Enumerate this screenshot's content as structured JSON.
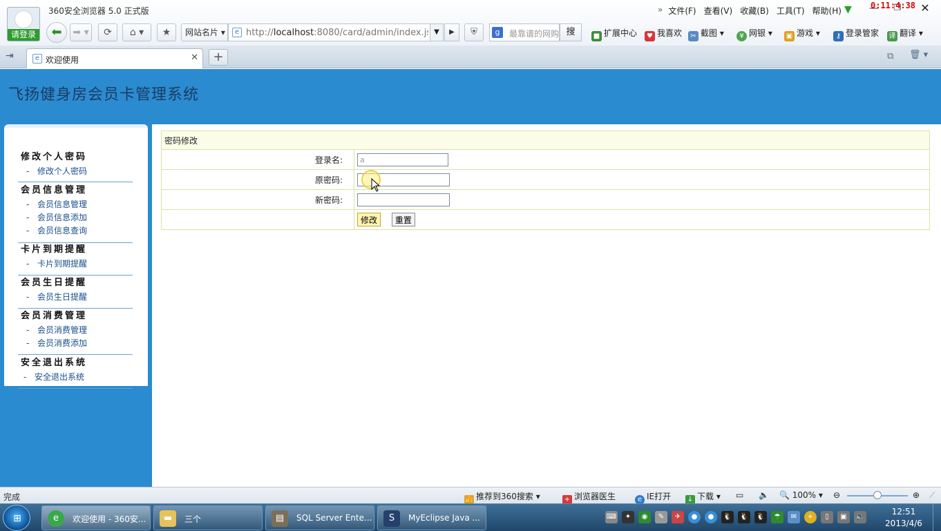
{
  "browser": {
    "app_title": "360安全浏览器 5.0 正式版",
    "login_label": "请登录",
    "menu": [
      "文件(F)",
      "查看(V)",
      "收藏(B)",
      "工具(T)",
      "帮助(H)"
    ],
    "recording_timer": "0:11:4:38",
    "site_names_label": "网站名片",
    "address": {
      "host_prefix": "http://",
      "host": "localhost",
      "rest": ":8080/card/admin/index.jsp"
    },
    "search_placeholder": "最靠谱的网购",
    "search_button": "搜",
    "extensions": [
      "扩展中心",
      "我喜欢",
      "截图",
      "网银",
      "游戏",
      "登录管家",
      "翻译"
    ],
    "tab": {
      "title": "欢迎使用"
    }
  },
  "page": {
    "site_title": "飞扬健身房会员卡管理系统",
    "nav": [
      {
        "heading": "修改个人密码",
        "items": [
          "修改个人密码"
        ]
      },
      {
        "heading": "会员信息管理",
        "items": [
          "会员信息管理",
          "会员信息添加",
          "会员信息查询"
        ]
      },
      {
        "heading": "卡片到期提醒",
        "items": [
          "卡片到期提醒"
        ]
      },
      {
        "heading": "会员生日提醒",
        "items": [
          "会员生日提醒"
        ]
      },
      {
        "heading": "会员消费管理",
        "items": [
          "会员消费管理",
          "会员消费添加"
        ]
      },
      {
        "heading": "安全退出系统",
        "items": [
          "安全退出系统"
        ]
      }
    ],
    "form": {
      "caption": "密码修改",
      "login_name_label": "登录名:",
      "login_name_value": "a",
      "old_password_label": "原密码:",
      "old_password_value": "",
      "new_password_label": "新密码:",
      "new_password_value": "",
      "submit_label": "修改",
      "reset_label": "重置"
    }
  },
  "statusbar": {
    "status": "完成",
    "recommend": "推荐到360搜索",
    "doctor": "浏览器医生",
    "ie_open": "IE打开",
    "download": "下载",
    "zoom": "100%",
    "zoom_level": 0.5
  },
  "taskbar": {
    "tasks": [
      "欢迎使用 - 360安...",
      "三个",
      "SQL Server Ente...",
      "MyEclipse Java ..."
    ],
    "time": "12:51",
    "date": "2013/4/6"
  },
  "colors": {
    "header_blue": "#2b8bd0",
    "site_title": "#1a3c63",
    "form_border": "#d6e4a6",
    "caption_bg": "#fbfde8"
  }
}
